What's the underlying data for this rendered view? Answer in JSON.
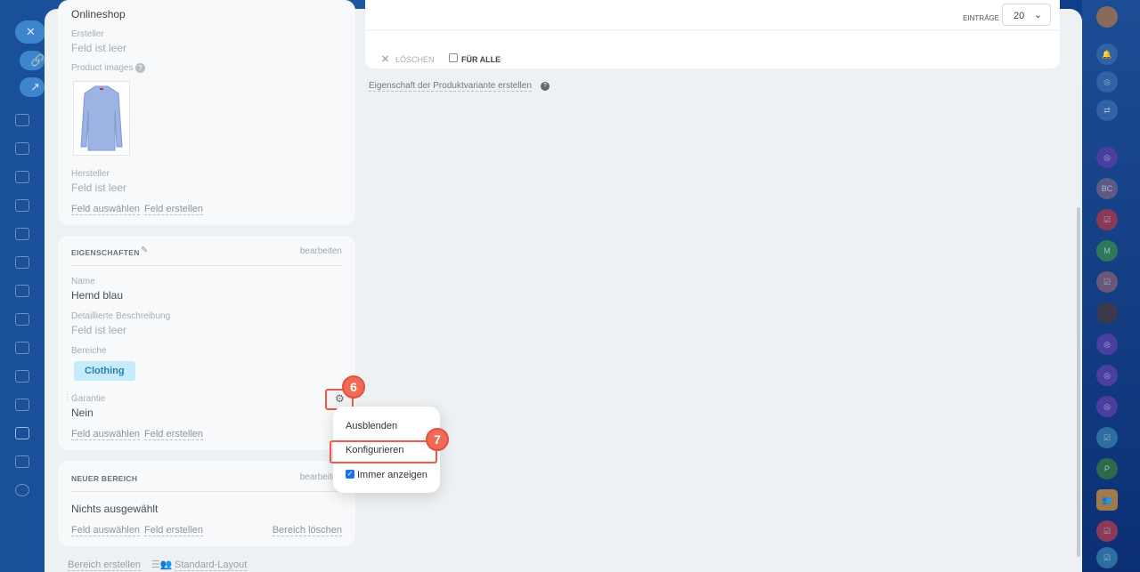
{
  "left_nav": {
    "close_label": "✕",
    "link_icon": "link-icon",
    "open_icon": "external-link-icon"
  },
  "card1": {
    "store": "Onlineshop",
    "creator_label": "Ersteller",
    "creator_value": "Feld ist leer",
    "images_label": "Product images",
    "manufacturer_label": "Hersteller",
    "manufacturer_value": "Feld ist leer",
    "select_field": "Feld auswählen",
    "create_field": "Feld erstellen"
  },
  "card2": {
    "title": "EIGENSCHAFTEN",
    "edit": "bearbeiten",
    "name_label": "Name",
    "name_value": "Hemd blau",
    "desc_label": "Detaillierte Beschreibung",
    "desc_value": "Feld ist leer",
    "sections_label": "Bereiche",
    "section_tag": "Clothing",
    "warranty_label": "Garantie",
    "warranty_value": "Nein",
    "select_field": "Feld auswählen",
    "create_field": "Feld erstellen"
  },
  "card3": {
    "title": "NEUER BEREICH",
    "edit": "bearbeiten",
    "value": "Nichts ausgewählt",
    "select_field": "Feld auswählen",
    "create_field": "Feld erstellen",
    "delete_section": "Bereich löschen"
  },
  "footer": {
    "create_section": "Bereich erstellen",
    "standard_layout": "Standard-Layout"
  },
  "right": {
    "entries_label": "EINTRÄGE",
    "entries_value": "20",
    "delete": "LÖSCHEN",
    "for_all": "FÜR ALLE",
    "create_variant_property": "Eigenschaft der Produktvariante erstellen"
  },
  "context_menu": {
    "items": [
      "Ausblenden",
      "Konfigurieren",
      "Immer anzeigen"
    ],
    "always_show_checked": true
  },
  "badges": {
    "step6": "6",
    "step7": "7"
  },
  "right_sidebar": {
    "avatars": [
      "BC",
      "M",
      "P"
    ]
  },
  "colors": {
    "accent": "#3d86cf",
    "highlight": "#ee5a4a",
    "tag_bg": "#c6ecfb"
  }
}
